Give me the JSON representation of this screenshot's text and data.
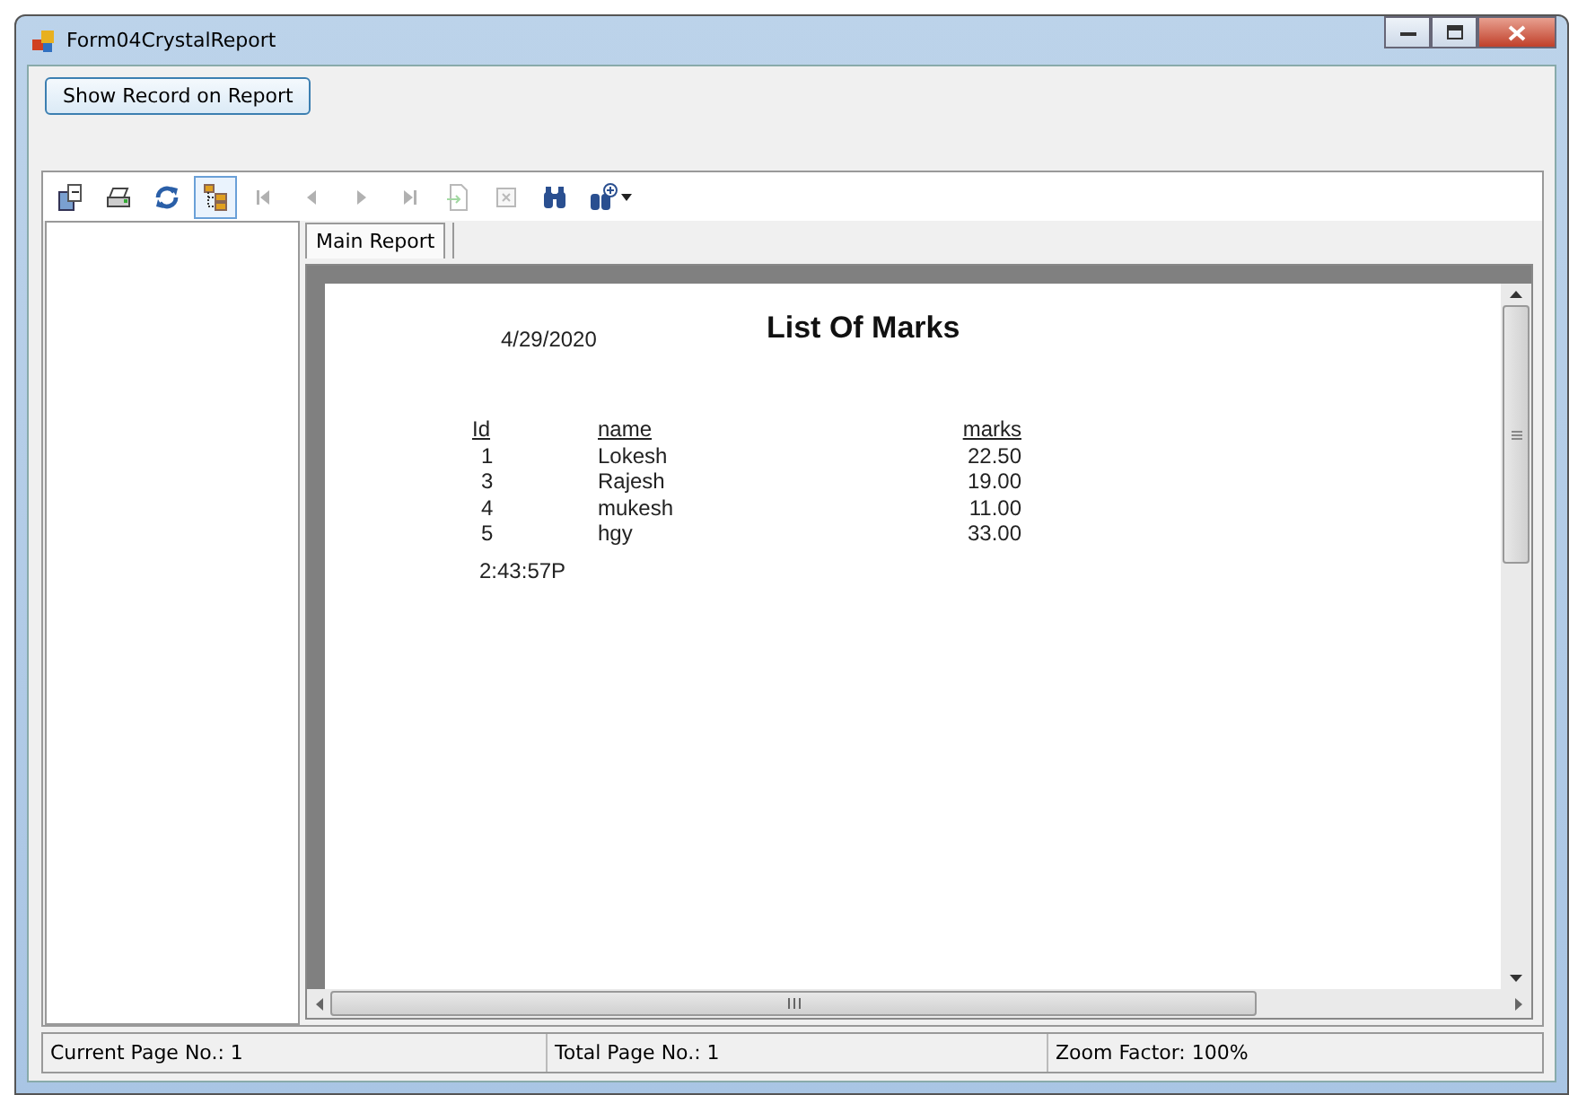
{
  "window": {
    "title": "Form04CrystalReport"
  },
  "show_button": {
    "label": "Show Record on Report"
  },
  "toolbar": [
    {
      "kind": "export",
      "disabled": false,
      "selected": false
    },
    {
      "kind": "print",
      "disabled": false,
      "selected": false
    },
    {
      "kind": "refresh",
      "disabled": false,
      "selected": false
    },
    {
      "kind": "tree",
      "disabled": false,
      "selected": true
    },
    {
      "kind": "first",
      "disabled": true,
      "selected": false
    },
    {
      "kind": "prev",
      "disabled": true,
      "selected": false
    },
    {
      "kind": "next",
      "disabled": true,
      "selected": false
    },
    {
      "kind": "last",
      "disabled": true,
      "selected": false
    },
    {
      "kind": "goto",
      "disabled": true,
      "selected": false
    },
    {
      "kind": "stop",
      "disabled": true,
      "selected": false
    },
    {
      "kind": "find",
      "disabled": false,
      "selected": false
    },
    {
      "kind": "zoom",
      "disabled": false,
      "selected": false
    }
  ],
  "tabs": [
    {
      "label": "Main Report",
      "selected": true
    }
  ],
  "report": {
    "date": "4/29/2020",
    "title": "List Of Marks",
    "columns": [
      "Id",
      "name",
      "marks"
    ],
    "rows": [
      [
        "1",
        "Lokesh",
        "22.50"
      ],
      [
        "3",
        "Rajesh",
        "19.00"
      ],
      [
        "4",
        "mukesh",
        "11.00"
      ],
      [
        "5",
        "hgy",
        "33.00"
      ]
    ],
    "time": "2:43:57P"
  },
  "status_bar": [
    "Current Page No.: 1",
    "Total Page No.: 1",
    "Zoom Factor: 100%"
  ]
}
